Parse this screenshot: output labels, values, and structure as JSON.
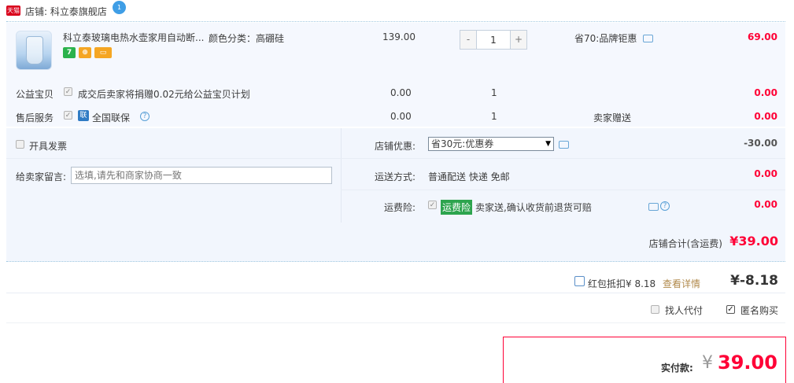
{
  "shop": {
    "badge": "天猫",
    "label": "店铺: 科立泰旗舰店",
    "chat_badge": "1"
  },
  "item": {
    "title": "科立泰玻璃电热水壶家用自动断...",
    "attr": "颜色分类：高硼硅",
    "price": "139.00",
    "qty_minus": "-",
    "qty_value": "1",
    "qty_plus": "+",
    "discount": "省70:品牌钜惠",
    "subtotal": "69.00",
    "badges": [
      "7",
      "⊕",
      "▭"
    ]
  },
  "charity": {
    "label": "公益宝贝",
    "desc": "成交后卖家将捐赠0.02元给公益宝贝计划",
    "price": "0.00",
    "qty": "1",
    "amount": "0.00"
  },
  "aftersale": {
    "label": "售后服务",
    "tag": "联",
    "desc": "全国联保",
    "help": "?",
    "price": "0.00",
    "qty": "1",
    "note": "卖家赠送",
    "amount": "0.00"
  },
  "invoice": {
    "label": "开具发票"
  },
  "coupon": {
    "label": "店铺优惠:",
    "selected": "省30元:优惠券",
    "amount": "-30.00"
  },
  "message": {
    "label": "给卖家留言:",
    "placeholder": "选填,请先和商家协商一致"
  },
  "shipping": {
    "label": "运送方式:",
    "value": "普通配送 快递 免邮",
    "amount": "0.00"
  },
  "insurance": {
    "label": "运费险:",
    "tag": "运费险",
    "desc": "卖家送,确认收货前退货可赔",
    "help": "?",
    "amount": "0.00"
  },
  "shop_total": {
    "label": "店铺合计(含运费)",
    "value": "¥39.00"
  },
  "redpacket": {
    "label": "红包抵扣¥ 8.18",
    "link": "查看详情",
    "value": "¥-8.18"
  },
  "options": {
    "proxy_label": "找人代付",
    "anon_label": "匿名购买"
  },
  "payment": {
    "label": "实付款:",
    "currency": "¥",
    "value": "39.00"
  },
  "colors": {
    "accent_red": "#ff0036",
    "panel_blue": "#f2f6fd",
    "tmall_red": "#d9001b"
  }
}
